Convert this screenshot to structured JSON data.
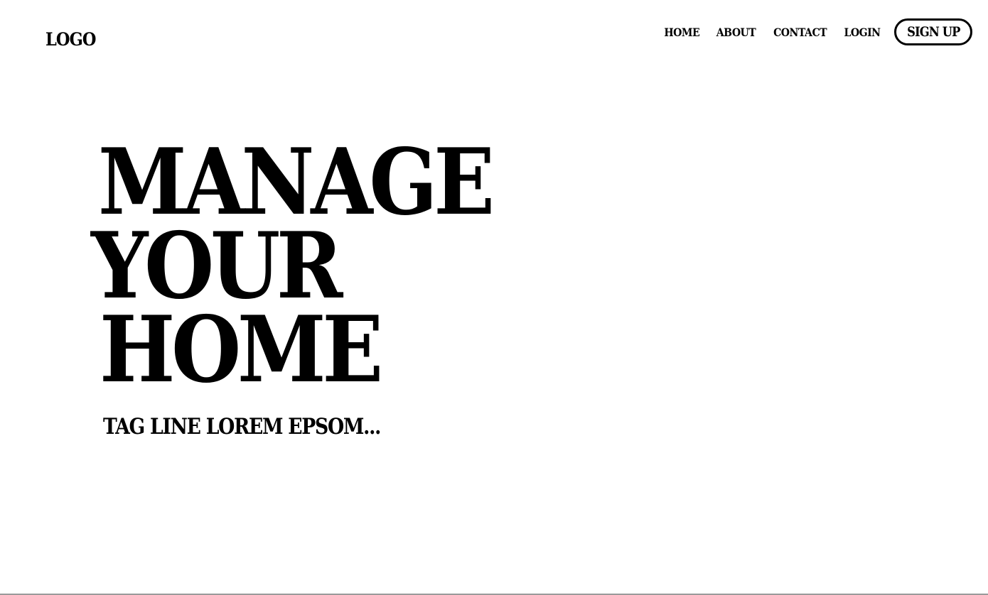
{
  "header": {
    "logo": "LOGO",
    "nav": {
      "home": "HOME",
      "about": "ABOUT",
      "contact": "CONTACT",
      "login": "LOGIN",
      "signup": "SIGN UP"
    }
  },
  "hero": {
    "line1": "MANAGE",
    "line2": "YOUR",
    "line3": "HOME",
    "tagline": "TAG LINE LOREM EPSOM..."
  },
  "colors": {
    "background": "#ffffff",
    "text": "#000000"
  }
}
